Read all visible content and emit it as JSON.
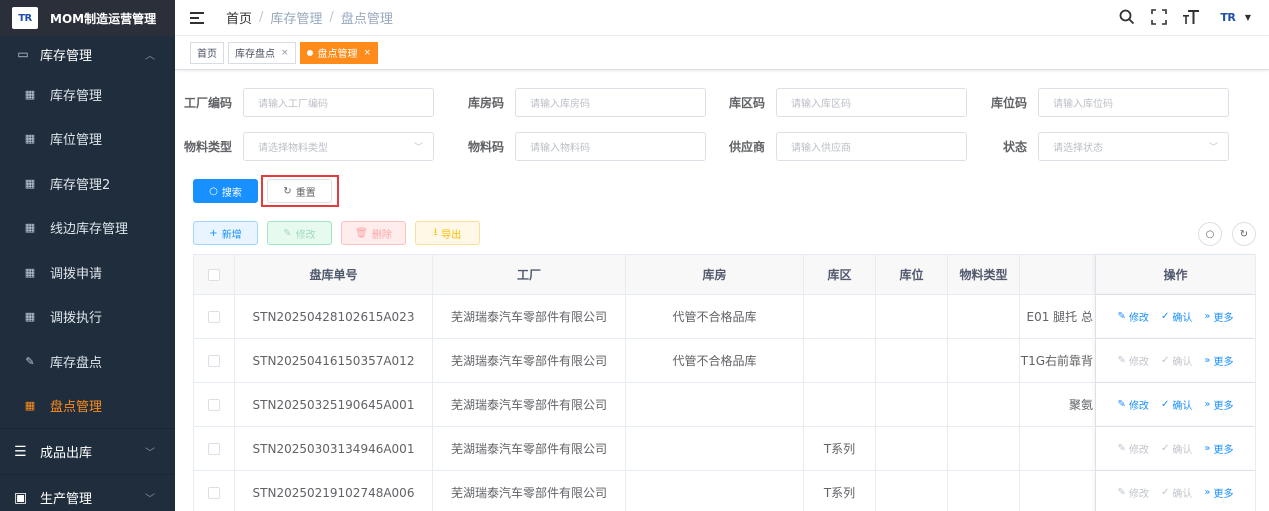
{
  "app": {
    "logo_text": "TR",
    "title": "MOM制造运营管理"
  },
  "sidebar": {
    "group": {
      "label": "库存管理",
      "icon": "monitor-icon"
    },
    "items": [
      {
        "label": "库存管理",
        "icon": "table-icon"
      },
      {
        "label": "库位管理",
        "icon": "table-icon"
      },
      {
        "label": "库存管理2",
        "icon": "table-icon"
      },
      {
        "label": "线边库存管理",
        "icon": "table-icon"
      },
      {
        "label": "调拨申请",
        "icon": "table-icon"
      },
      {
        "label": "调拨执行",
        "icon": "table-icon"
      },
      {
        "label": "库存盘点",
        "icon": "edit-icon"
      },
      {
        "label": "盘点管理",
        "icon": "table-icon",
        "active": true
      }
    ],
    "group2": {
      "label": "成品出库",
      "icon": "list-icon"
    },
    "group3": {
      "label": "生产管理",
      "icon": "box-icon"
    }
  },
  "header": {
    "breadcrumb": [
      "首页",
      "库存管理",
      "盘点管理"
    ],
    "avatar_text": "TR"
  },
  "tags": [
    {
      "label": "首页",
      "closable": false
    },
    {
      "label": "库存盘点",
      "closable": true
    },
    {
      "label": "盘点管理",
      "closable": true,
      "active": true
    }
  ],
  "form": {
    "factory_code": {
      "label": "工厂编码",
      "placeholder": "请输入工厂编码"
    },
    "warehouse_code": {
      "label": "库房码",
      "placeholder": "请输入库房码"
    },
    "zone_code": {
      "label": "库区码",
      "placeholder": "请输入库区码"
    },
    "location_code": {
      "label": "库位码",
      "placeholder": "请输入库位码"
    },
    "material_type": {
      "label": "物料类型",
      "placeholder": "请选择物料类型"
    },
    "material_code": {
      "label": "物料码",
      "placeholder": "请输入物料码"
    },
    "supplier": {
      "label": "供应商",
      "placeholder": "请输入供应商"
    },
    "status": {
      "label": "状态",
      "placeholder": "请选择状态"
    },
    "search_label": "搜索",
    "reset_label": "重置"
  },
  "toolbar": {
    "add": "新增",
    "edit": "修改",
    "delete": "删除",
    "export": "导出"
  },
  "table": {
    "columns": [
      "盘库单号",
      "工厂",
      "库房",
      "库区",
      "库位",
      "物料类型",
      "",
      "操作"
    ],
    "ops": {
      "edit": "修改",
      "confirm": "确认",
      "more": "更多"
    },
    "rows": [
      {
        "no": "STN20250428102615A023",
        "factory": "芜湖瑞泰汽车零部件有限公司",
        "warehouse": "代管不合格品库",
        "zone": "",
        "location": "",
        "mtype": "",
        "extra": "E01 腿托 总",
        "edit_enabled": true
      },
      {
        "no": "STN20250416150357A012",
        "factory": "芜湖瑞泰汽车零部件有限公司",
        "warehouse": "代管不合格品库",
        "zone": "",
        "location": "",
        "mtype": "",
        "extra": "T1G右前靠背",
        "edit_enabled": false
      },
      {
        "no": "STN20250325190645A001",
        "factory": "芜湖瑞泰汽车零部件有限公司",
        "warehouse": "",
        "zone": "",
        "location": "",
        "mtype": "",
        "extra": "聚氨",
        "edit_enabled": true
      },
      {
        "no": "STN20250303134946A001",
        "factory": "芜湖瑞泰汽车零部件有限公司",
        "warehouse": "",
        "zone": "T系列",
        "location": "",
        "mtype": "",
        "extra": "",
        "edit_enabled": false
      },
      {
        "no": "STN20250219102748A006",
        "factory": "芜湖瑞泰汽车零部件有限公司",
        "warehouse": "",
        "zone": "T系列",
        "location": "",
        "mtype": "",
        "extra": "",
        "edit_enabled": false
      }
    ]
  },
  "colors": {
    "accent": "#ff8c1a",
    "primary": "#1890ff",
    "sidebar_bg": "#1f2d3d",
    "highlight": "#e8393b"
  }
}
